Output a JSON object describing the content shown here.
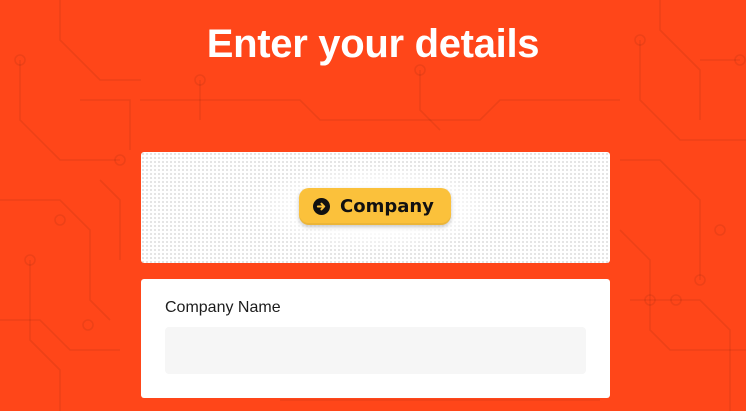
{
  "page": {
    "title": "Enter your details",
    "background_color": "#ff4619"
  },
  "preview": {
    "tag_label": "Company",
    "tag_icon": "arrow-right-circle-icon",
    "tag_color": "#fbc13b"
  },
  "form": {
    "company_name_label": "Company Name",
    "company_name_value": "",
    "company_name_placeholder": ""
  }
}
